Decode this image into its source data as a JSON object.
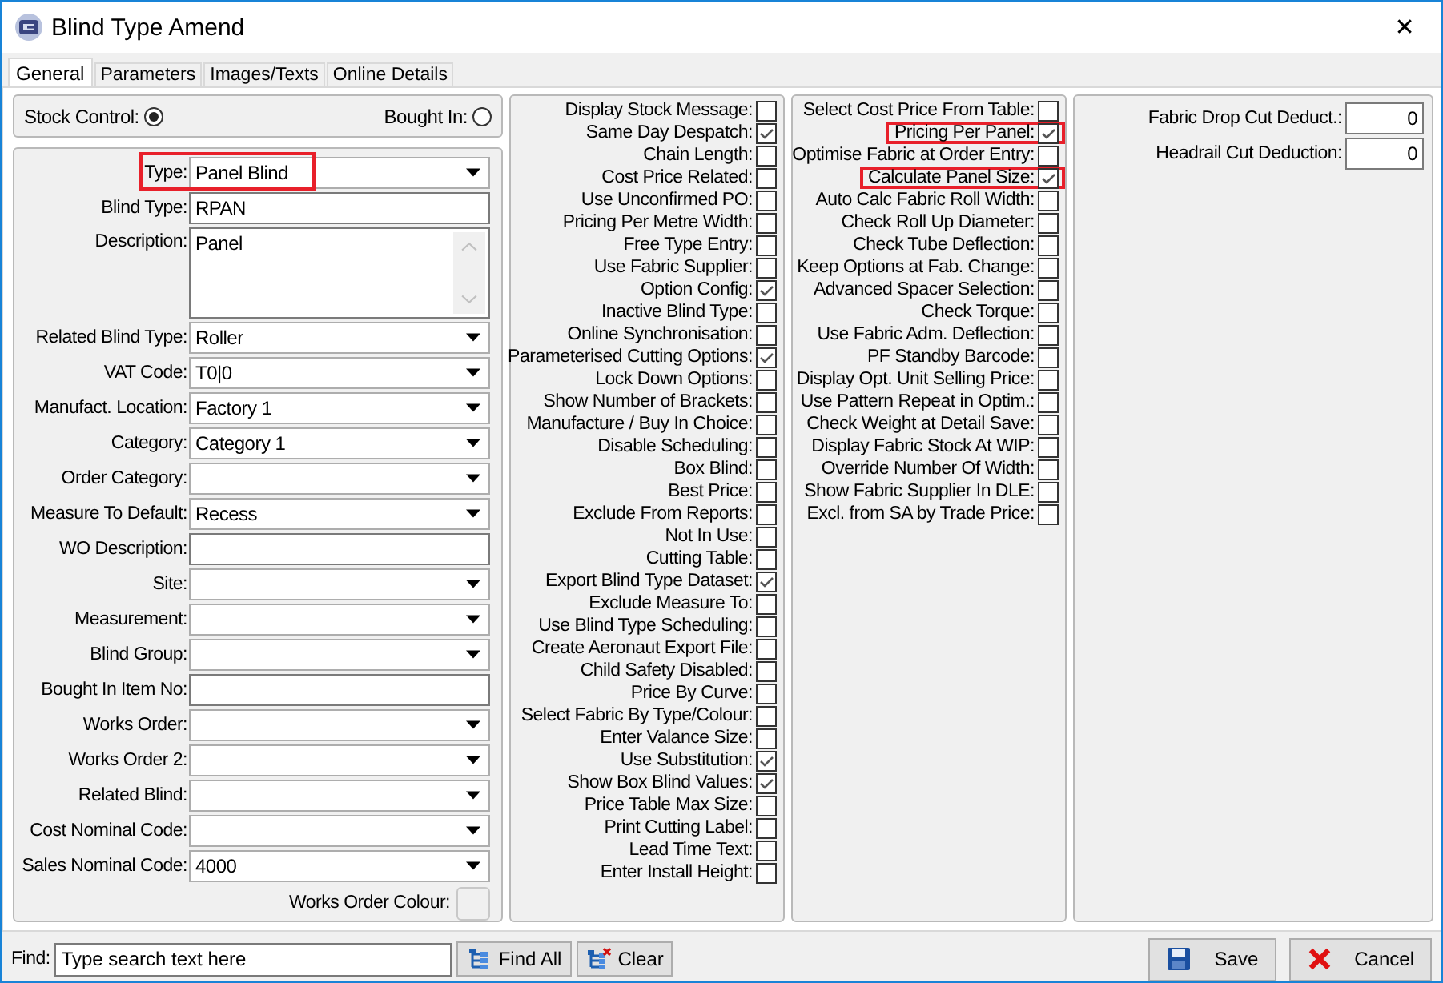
{
  "window": {
    "title": "Blind Type Amend",
    "close": "✕"
  },
  "tabs": [
    {
      "label": "General",
      "selected": true
    },
    {
      "label": "Parameters",
      "selected": false
    },
    {
      "label": "Images/Texts",
      "selected": false
    },
    {
      "label": "Online Details",
      "selected": false
    }
  ],
  "stock_options": [
    {
      "label": "Stock Control:",
      "selected": true
    },
    {
      "label": "Bought In:",
      "selected": false
    }
  ],
  "fields": [
    {
      "label": "Type:",
      "kind": "dropdown",
      "value": "Panel Blind",
      "highlighted": true
    },
    {
      "label": "Blind Type:",
      "kind": "text",
      "value": "RPAN",
      "highlighted": false
    },
    {
      "label": "Description:",
      "kind": "memo",
      "value": "Panel",
      "highlighted": false
    },
    {
      "label": "Related Blind Type:",
      "kind": "dropdown",
      "value": "Roller",
      "highlighted": false
    },
    {
      "label": "VAT Code:",
      "kind": "dropdown",
      "value": "T0|0",
      "highlighted": false
    },
    {
      "label": "Manufact. Location:",
      "kind": "dropdown",
      "value": "Factory 1",
      "highlighted": false
    },
    {
      "label": "Category:",
      "kind": "dropdown",
      "value": "Category 1",
      "highlighted": false
    },
    {
      "label": "Order Category:",
      "kind": "dropdown",
      "highlighted": false
    },
    {
      "label": "Measure To Default:",
      "kind": "dropdown",
      "value": "Recess",
      "highlighted": false
    },
    {
      "label": "WO Description:",
      "kind": "text",
      "highlighted": false
    },
    {
      "label": "Site:",
      "kind": "dropdown",
      "highlighted": false
    },
    {
      "label": "Measurement:",
      "kind": "dropdown",
      "highlighted": false
    },
    {
      "label": "Blind Group:",
      "kind": "dropdown",
      "highlighted": false
    },
    {
      "label": "Bought In Item No:",
      "kind": "text",
      "highlighted": false
    },
    {
      "label": "Works Order:",
      "kind": "dropdown",
      "highlighted": false
    },
    {
      "label": "Works Order 2:",
      "kind": "dropdown",
      "highlighted": false
    },
    {
      "label": "Related Blind:",
      "kind": "dropdown",
      "highlighted": false
    },
    {
      "label": "Cost Nominal Code:",
      "kind": "dropdown",
      "highlighted": false
    },
    {
      "label": "Sales Nominal Code:",
      "kind": "dropdown",
      "value": "4000",
      "highlighted": false
    }
  ],
  "works_order_colour": {
    "label": "Works Order Colour:"
  },
  "options_1": [
    {
      "label": "Display Stock Message:",
      "checked": false
    },
    {
      "label": "Same Day Despatch:",
      "checked": true
    },
    {
      "label": "Chain Length:",
      "checked": false
    },
    {
      "label": "Cost Price Related:",
      "checked": false
    },
    {
      "label": "Use Unconfirmed PO:",
      "checked": false
    },
    {
      "label": "Pricing Per Metre Width:",
      "checked": false
    },
    {
      "label": "Free Type Entry:",
      "checked": false
    },
    {
      "label": "Use Fabric Supplier:",
      "checked": false
    },
    {
      "label": "Option Config:",
      "checked": true
    },
    {
      "label": "Inactive Blind Type:",
      "checked": false
    },
    {
      "label": "Online Synchronisation:",
      "checked": false
    },
    {
      "label": "Parameterised Cutting Options:",
      "checked": true
    },
    {
      "label": "Lock Down Options:",
      "checked": false
    },
    {
      "label": "Show Number of Brackets:",
      "checked": false
    },
    {
      "label": "Manufacture / Buy In Choice:",
      "checked": false
    },
    {
      "label": "Disable Scheduling:",
      "checked": false
    },
    {
      "label": "Box Blind:",
      "checked": false
    },
    {
      "label": "Best Price:",
      "checked": false
    },
    {
      "label": "Exclude From Reports:",
      "checked": false
    },
    {
      "label": "Not In Use:",
      "checked": false
    },
    {
      "label": "Cutting Table:",
      "checked": false
    },
    {
      "label": "Export Blind Type Dataset:",
      "checked": true
    },
    {
      "label": "Exclude Measure To:",
      "checked": false
    },
    {
      "label": "Use Blind Type Scheduling:",
      "checked": false
    },
    {
      "label": "Create Aeronaut Export File:",
      "checked": false
    },
    {
      "label": "Child Safety Disabled:",
      "checked": false
    },
    {
      "label": "Price By Curve:",
      "checked": false
    },
    {
      "label": "Select Fabric By Type/Colour:",
      "checked": false
    },
    {
      "label": "Enter Valance Size:",
      "checked": false
    },
    {
      "label": "Use Substitution:",
      "checked": true
    },
    {
      "label": "Show Box Blind Values:",
      "checked": true
    },
    {
      "label": "Price Table Max Size:",
      "checked": false
    },
    {
      "label": "Print Cutting Label:",
      "checked": false
    },
    {
      "label": "Lead Time Text:",
      "checked": false
    },
    {
      "label": "Enter Install Height:",
      "checked": false
    }
  ],
  "options_2": [
    {
      "label": "Select Cost Price From Table:",
      "checked": false,
      "highlighted": false
    },
    {
      "label": "Pricing Per Panel:",
      "checked": true,
      "highlighted": true
    },
    {
      "label": "Optimise Fabric at Order Entry:",
      "checked": false,
      "highlighted": false
    },
    {
      "label": "Calculate Panel Size:",
      "checked": true,
      "highlighted": true
    },
    {
      "label": "Auto Calc Fabric Roll Width:",
      "checked": false,
      "highlighted": false
    },
    {
      "label": "Check Roll Up Diameter:",
      "checked": false,
      "highlighted": false
    },
    {
      "label": "Check Tube Deflection:",
      "checked": false,
      "highlighted": false
    },
    {
      "label": "Keep Options at Fab. Change:",
      "checked": false,
      "highlighted": false
    },
    {
      "label": "Advanced Spacer Selection:",
      "checked": false,
      "highlighted": false
    },
    {
      "label": "Check Torque:",
      "checked": false,
      "highlighted": false
    },
    {
      "label": "Use Fabric Adm. Deflection:",
      "checked": false,
      "highlighted": false
    },
    {
      "label": "PF Standby Barcode:",
      "checked": false,
      "highlighted": false
    },
    {
      "label": "Display Opt. Unit Selling Price:",
      "checked": false,
      "highlighted": false
    },
    {
      "label": "Use Pattern Repeat in Optim.:",
      "checked": false,
      "highlighted": false
    },
    {
      "label": "Check Weight at Detail Save:",
      "checked": false,
      "highlighted": false
    },
    {
      "label": "Display Fabric Stock At WIP:",
      "checked": false,
      "highlighted": false
    },
    {
      "label": "Override Number Of Width:",
      "checked": false,
      "highlighted": false
    },
    {
      "label": "Show Fabric Supplier In DLE:",
      "checked": false,
      "highlighted": false
    },
    {
      "label": "Excl. from SA by Trade Price:",
      "checked": false,
      "highlighted": false
    }
  ],
  "deductions": [
    {
      "label": "Fabric Drop Cut Deduct.:",
      "value": "0"
    },
    {
      "label": "Headrail Cut Deduction:",
      "value": "0"
    }
  ],
  "footer": {
    "find_label": "Find:",
    "find_placeholder": "Type search text here",
    "find_all": "Find All",
    "clear": "Clear",
    "save": "Save",
    "cancel": "Cancel"
  }
}
